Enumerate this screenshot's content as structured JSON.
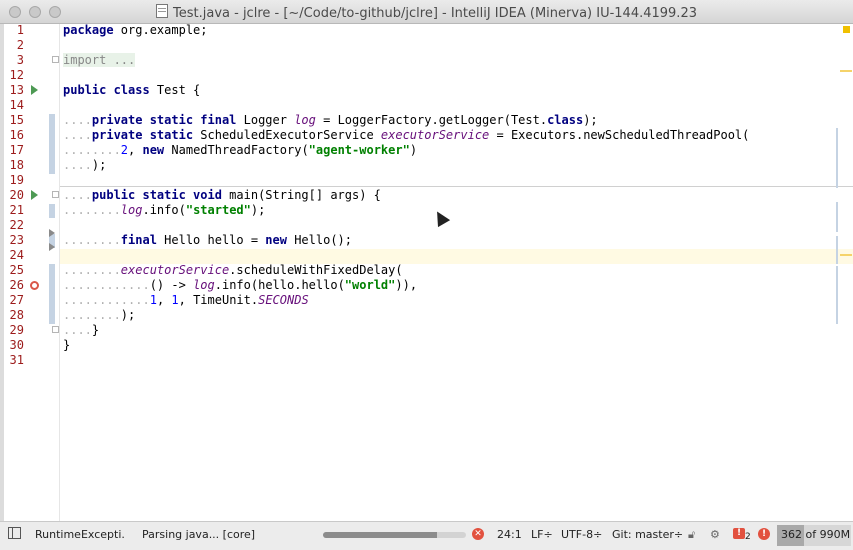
{
  "window": {
    "title": "Test.java - jclre - [~/Code/to-github/jclre] - IntelliJ IDEA (Minerva) IU-144.4199.23"
  },
  "gutter": {
    "line_numbers": [
      "1",
      "2",
      "3",
      "12",
      "13",
      "14",
      "15",
      "16",
      "17",
      "18",
      "19",
      "20",
      "21",
      "22",
      "23",
      "24",
      "25",
      "26",
      "27",
      "28",
      "29",
      "30",
      "31"
    ]
  },
  "code": {
    "l1": {
      "kw": "package",
      "rest": " org.example;"
    },
    "l3": {
      "kw": "import",
      "fold": " ..."
    },
    "l13": {
      "kw": "public class",
      "rest": " Test {"
    },
    "l15": {
      "indent": "....",
      "kw": "private static final",
      "t1": " Logger ",
      "field": "log",
      "t2": " = LoggerFactory.getLogger(Test.",
      "kw2": "class",
      "t3": ");"
    },
    "l16": {
      "indent": "....",
      "kw": "private static",
      "t1": " ScheduledExecutorService ",
      "field": "executorService",
      "t2": " = Executors.newScheduledThreadPool("
    },
    "l17": {
      "indent": "........",
      "num": "2",
      "t1": ", ",
      "kw": "new",
      "t2": " NamedThreadFactory(",
      "str": "\"agent-worker\"",
      "t3": ")"
    },
    "l18": {
      "indent": "....",
      "t1": ");"
    },
    "l20": {
      "indent": "....",
      "kw": "public static void",
      "t1": " main(String[] args) {"
    },
    "l21": {
      "indent": "........",
      "field": "log",
      "t1": ".info(",
      "str": "\"started\"",
      "t2": ");"
    },
    "l23": {
      "indent": "........",
      "kw": "final",
      "t1": " Hello hello = ",
      "kw2": "new",
      "t2": " Hello();"
    },
    "l25": {
      "indent": "........",
      "field": "executorService",
      "t1": ".scheduleWithFixedDelay("
    },
    "l26": {
      "indent": "............",
      "t1": "() -> ",
      "field": "log",
      "t2": ".info(hello.hello(",
      "str": "\"world\"",
      "t3": ")),"
    },
    "l27": {
      "indent": "............",
      "num1": "1",
      "t1": ", ",
      "num2": "1",
      "t2": ", TimeUnit.",
      "field": "SECONDS"
    },
    "l28": {
      "indent": "........",
      "t1": ");"
    },
    "l29": {
      "indent": "....",
      "t1": "}"
    },
    "l30": {
      "t1": "}"
    }
  },
  "statusbar": {
    "event1": "RuntimeExcepti.",
    "task": "Parsing java... [core]",
    "progress": 0.8,
    "position": "24:1",
    "line_separator": "LF÷",
    "encoding": "UTF-8÷",
    "vcs": "Git: master÷",
    "error_count": "2",
    "memory": "362 of 990M",
    "memory_fraction": 0.366
  },
  "icons": {
    "stop": "stop-icon",
    "lock": "lock-icon",
    "inspector": "inspector-icon",
    "error": "error-icon",
    "event": "event-log-icon"
  },
  "colors": {
    "line_number": "#9c1b1b",
    "keyword": "#000080",
    "string": "#008000",
    "field": "#660e7a",
    "current_line": "#fffae3",
    "error_red": "#e2513f"
  }
}
